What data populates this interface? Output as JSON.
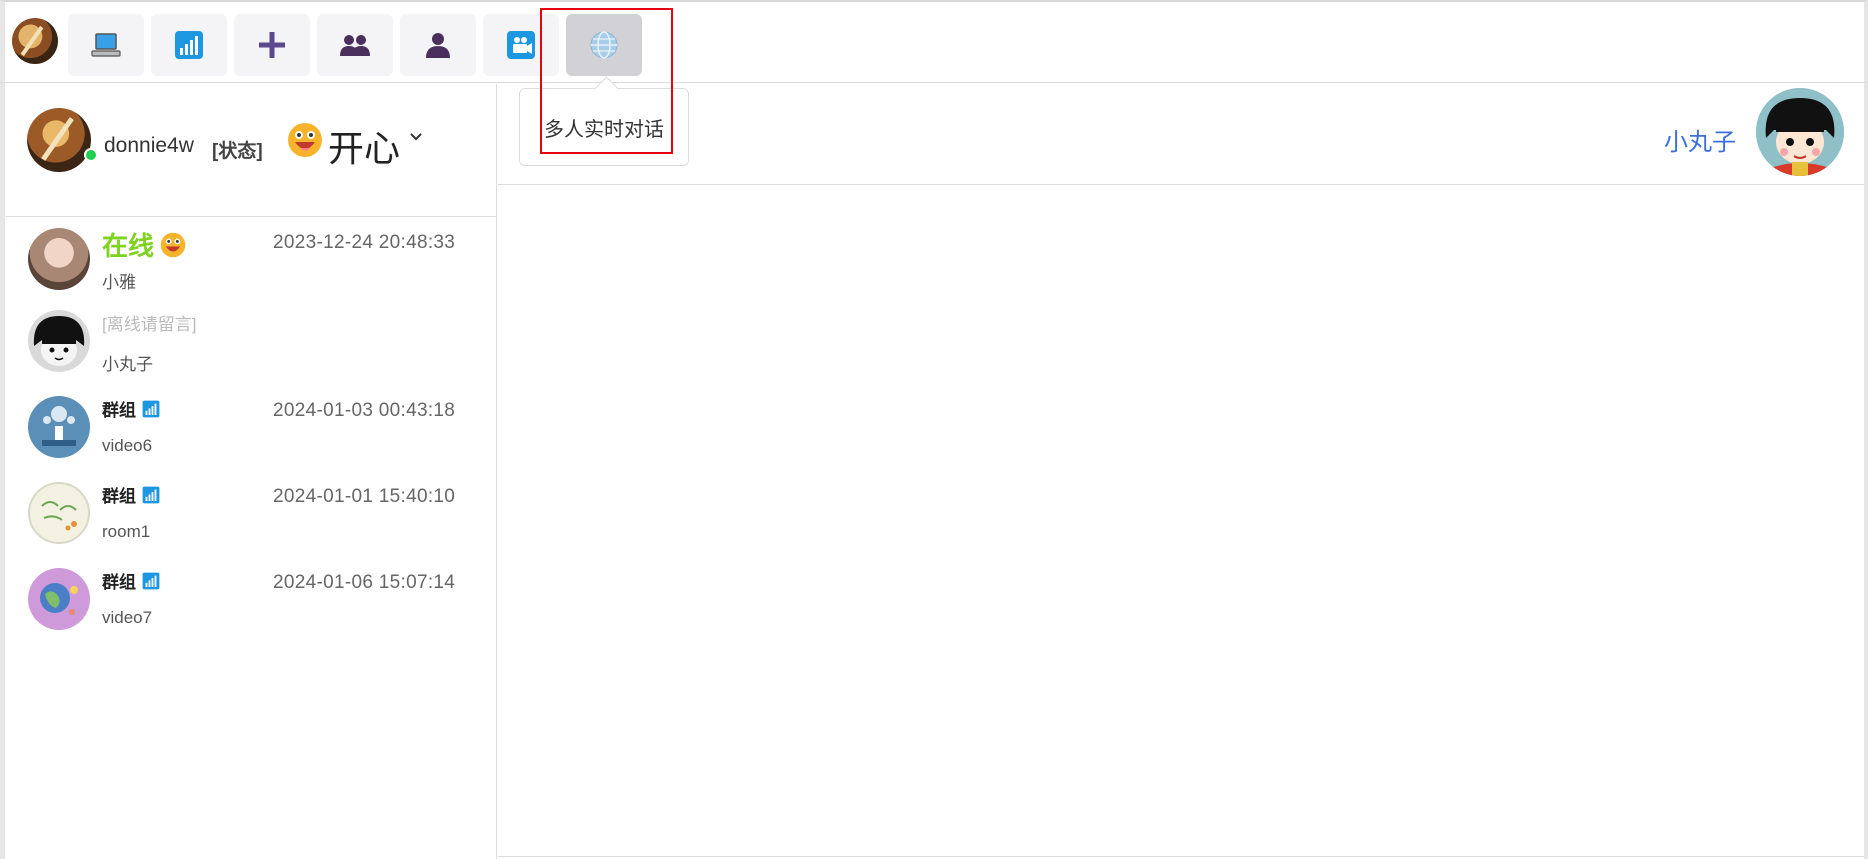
{
  "toolbar": {
    "buttons": [
      {
        "name": "computer-icon"
      },
      {
        "name": "signal-bars-icon"
      },
      {
        "name": "plus-icon"
      },
      {
        "name": "group-users-icon"
      },
      {
        "name": "user-icon"
      },
      {
        "name": "video-camera-icon"
      },
      {
        "name": "globe-icon",
        "active": true
      }
    ],
    "tooltip": "多人实时对话"
  },
  "profile": {
    "username": "donnie4w",
    "status_label": "[状态]",
    "mood": "开心",
    "online": true
  },
  "conversations": [
    {
      "title": "在线",
      "title_style": "online",
      "time": "2023-12-24 20:48:33",
      "subtitle": "小雅",
      "avatar": "girl-avatar"
    },
    {
      "title": "[离线请留言]",
      "title_style": "offline",
      "time": "",
      "subtitle": "小丸子",
      "avatar": "maruko-bw-avatar"
    },
    {
      "title": "群组",
      "title_style": "group",
      "time": "2024-01-03 00:43:18",
      "subtitle": "video6",
      "avatar": "group-blue-avatar"
    },
    {
      "title": "群组",
      "title_style": "group",
      "time": "2024-01-01 15:40:10",
      "subtitle": "room1",
      "avatar": "group-green-avatar"
    },
    {
      "title": "群组",
      "title_style": "group",
      "time": "2024-01-06 15:07:14",
      "subtitle": "video7",
      "avatar": "group-purple-avatar"
    }
  ],
  "chat_header": {
    "peer_name": "小丸子"
  },
  "colors": {
    "accent_blue": "#3a6fe0",
    "online_green": "#7ed321",
    "status_dot": "#1fd04f",
    "highlight_red": "#e60012"
  }
}
